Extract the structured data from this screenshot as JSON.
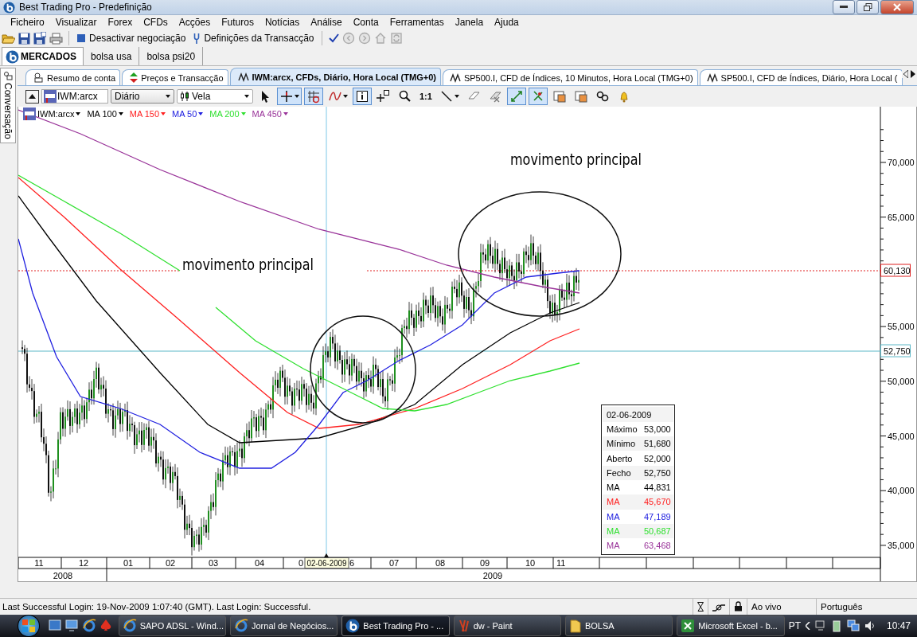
{
  "window": {
    "title": "Best Trading Pro - Predefinição"
  },
  "menu": [
    "Ficheiro",
    "Visualizar",
    "Forex",
    "CFDs",
    "Acções",
    "Futuros",
    "Notícias",
    "Análise",
    "Conta",
    "Ferramentas",
    "Janela",
    "Ajuda"
  ],
  "toolbar": {
    "buttons": [
      {
        "kind": "stop",
        "label": "Desactivar negociação"
      },
      {
        "kind": "settings",
        "label": "Definições da Transacção"
      }
    ],
    "nav": [
      {
        "kind": "back",
        "disabled": true
      },
      {
        "kind": "forward",
        "disabled": true
      },
      {
        "kind": "home",
        "disabled": true
      },
      {
        "kind": "refresh",
        "disabled": true
      }
    ]
  },
  "market_tabs": [
    {
      "label": "MERCADOS",
      "selected": true
    },
    {
      "label": "bolsa usa",
      "selected": false
    },
    {
      "label": "bolsa psi20",
      "selected": false
    }
  ],
  "side_panel": {
    "label": "Conversação"
  },
  "document_tabs": [
    {
      "kind": "account",
      "label": "Resumo de conta",
      "selected": false
    },
    {
      "kind": "prices",
      "label": "Preços e Transacção",
      "selected": false
    },
    {
      "kind": "chart",
      "label": "IWM:arcx, CFDs, Diário, Hora Local (TMG+0)",
      "selected": true
    },
    {
      "kind": "chart",
      "label": "SP500.I, CFD de Índices, 10 Minutos, Hora Local (TMG+0)",
      "selected": false
    },
    {
      "kind": "chart",
      "label": "SP500.I, CFD de Índices, Diário, Hora Local (",
      "selected": false
    }
  ],
  "chart_toolbar": {
    "symbol": "IWM:arcx",
    "period": "Diário",
    "chart_type": "Vela",
    "tools": [
      {
        "kind": "pointer",
        "selected": false
      },
      {
        "kind": "crosshair",
        "selected": true
      },
      {
        "kind": "grid",
        "selected": true
      },
      {
        "kind": "indicator",
        "selected": false
      },
      {
        "kind": "info",
        "selected": true
      },
      {
        "kind": "zoom-area",
        "selected": false
      },
      {
        "kind": "zoom",
        "selected": false
      },
      {
        "kind": "text",
        "label": "1:1",
        "selected": false
      },
      {
        "kind": "line",
        "selected": false
      },
      {
        "kind": "eraser",
        "selected": false
      },
      {
        "kind": "delete",
        "selected": false
      },
      {
        "kind": "autoscale",
        "selected": true
      },
      {
        "kind": "scale-link",
        "selected": true
      },
      {
        "kind": "template",
        "selected": false
      },
      {
        "kind": "template",
        "selected": false
      },
      {
        "kind": "link",
        "selected": false
      },
      {
        "kind": "alarm",
        "selected": false
      }
    ]
  },
  "legend": [
    {
      "label": "IWM:arcx",
      "color": "#000000"
    },
    {
      "label": "MA 100",
      "color": "#000000"
    },
    {
      "label": "MA 150",
      "color": "#ff2020"
    },
    {
      "label": "MA 50",
      "color": "#2020e0"
    },
    {
      "label": "MA 200",
      "color": "#30e030"
    },
    {
      "label": "MA 450",
      "color": "#993399"
    }
  ],
  "chart": {
    "annotations": [
      "movimento principal",
      "movimento principal"
    ],
    "y_axis_labels": [
      "70,000",
      "65,000",
      "55,000",
      "50,000",
      "45,000",
      "40,000",
      "35,000"
    ],
    "price_markers": [
      {
        "kind": "last",
        "label": "60,130"
      },
      {
        "kind": "cursor",
        "label": "52,750"
      }
    ],
    "months": [
      "11",
      "12",
      "01",
      "02",
      "03",
      "04",
      "0",
      "6",
      "07",
      "08",
      "09",
      "10",
      "11"
    ],
    "years": [
      "2008",
      "2009"
    ],
    "cursor_date": "02-06-2009"
  },
  "data_window": {
    "date": "02-06-2009",
    "rows": [
      {
        "label": "Máximo",
        "value": "53,000",
        "color": "#000000"
      },
      {
        "label": "Mínimo",
        "value": "51,680",
        "color": "#000000"
      },
      {
        "label": "Aberto",
        "value": "52,000",
        "color": "#000000"
      },
      {
        "label": "Fecho",
        "value": "52,750",
        "color": "#000000"
      },
      {
        "label": "MA",
        "value": "44,831",
        "color": "#000000"
      },
      {
        "label": "MA",
        "value": "45,670",
        "color": "#ff2020"
      },
      {
        "label": "MA",
        "value": "47,189",
        "color": "#2020e0"
      },
      {
        "label": "MA",
        "value": "50,687",
        "color": "#30e030"
      },
      {
        "label": "MA",
        "value": "63,468",
        "color": "#993399"
      }
    ]
  },
  "status_bar": {
    "message": "Last Successful Login: 19-Nov-2009 1:07:40 (GMT). Last Login: Successful.",
    "connection": "Ao vivo",
    "language": "Português"
  },
  "taskbar": {
    "tasks": [
      {
        "kind": "browser",
        "label": "SAPO ADSL - Wind...",
        "selected": false
      },
      {
        "kind": "browser",
        "label": "Jornal de Negócios...",
        "selected": false
      },
      {
        "kind": "app",
        "label": "Best Trading Pro - ...",
        "selected": true
      },
      {
        "kind": "paint",
        "label": "dw - Paint",
        "selected": false
      },
      {
        "kind": "folder",
        "label": "BOLSA",
        "selected": false
      },
      {
        "kind": "spreadsheet",
        "label": "Microsoft Excel - b...",
        "selected": false
      }
    ],
    "language": "PT",
    "clock": "10:47"
  }
}
